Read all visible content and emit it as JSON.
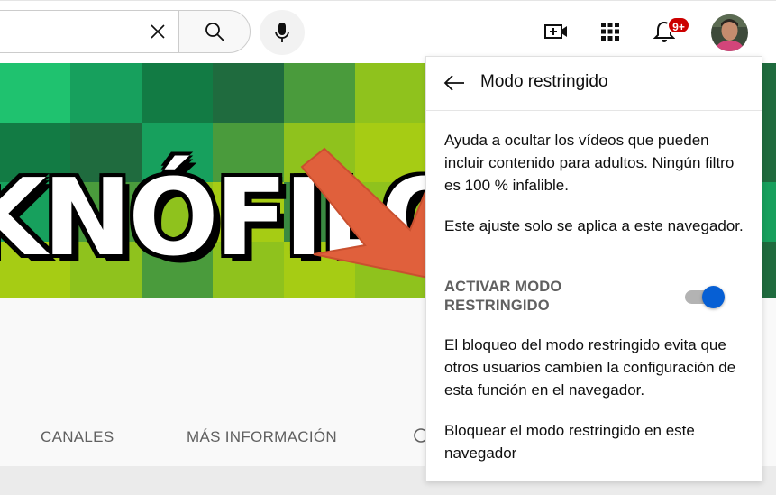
{
  "header": {
    "search": {
      "value": "",
      "placeholder": ""
    },
    "notifications_badge": "9+"
  },
  "banner": {
    "title": "KNÓFILO",
    "colors": [
      "#1fc26f",
      "#17a05d",
      "#127b44",
      "#1f6b3e",
      "#4a9b3c",
      "#8fc21d",
      "#a6cc14",
      "#3a8a41"
    ]
  },
  "tabs": [
    "CANALES",
    "MÁS INFORMACIÓN"
  ],
  "menu": {
    "title": "Modo restringido",
    "description": "Ayuda a ocultar los vídeos que pueden incluir contenido para adultos. Ningún filtro es 100 % infalible.",
    "browser_note": "Este ajuste solo se aplica a este navegador.",
    "toggle_label": "ACTIVAR MODO RESTRINGIDO",
    "toggle_on": true,
    "lock_info": "El bloqueo del modo restringido evita que otros usuarios cambien la configuración de esta función en el navegador.",
    "lock_link": "Bloquear el modo restringido en este navegador"
  },
  "colors": {
    "accent": "#065fd4",
    "badge": "#cc0000",
    "arrow": "#e0603c"
  }
}
